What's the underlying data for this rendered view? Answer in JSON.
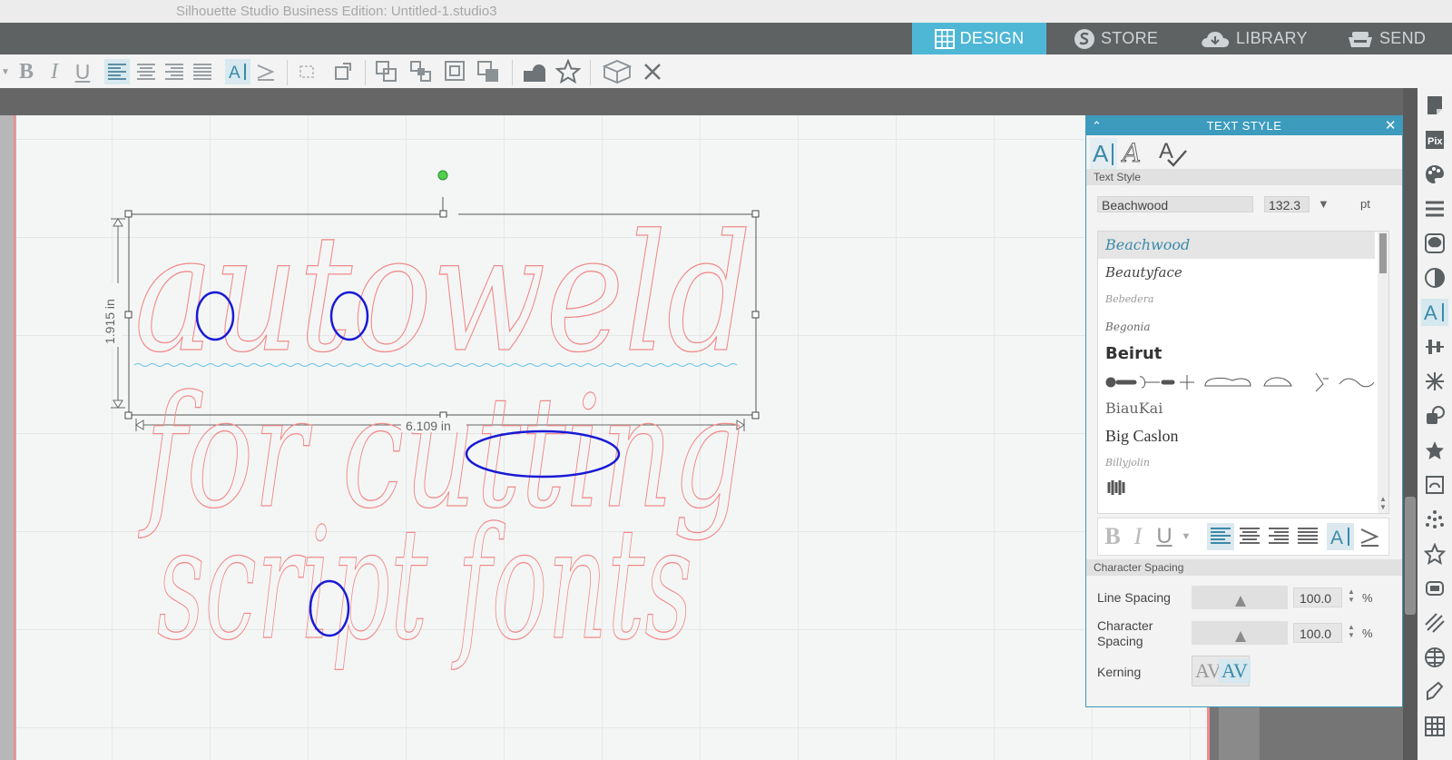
{
  "window": {
    "title": "Silhouette Studio Business Edition: Untitled-1.studio3"
  },
  "nav": {
    "tabs": [
      {
        "label": "DESIGN",
        "icon": "grid-icon",
        "active": true
      },
      {
        "label": "STORE",
        "icon": "silhouette-s-icon",
        "active": false
      },
      {
        "label": "LIBRARY",
        "icon": "cloud-download-icon",
        "active": false
      },
      {
        "label": "SEND",
        "icon": "cutter-icon",
        "active": false
      }
    ]
  },
  "toolbar": {
    "bold": "B",
    "italic": "I",
    "underline": "U"
  },
  "canvas": {
    "lines": [
      "autoweld",
      "for cutting",
      "script fonts"
    ],
    "height_label": "1.915 in",
    "width_label": "6.109 in",
    "outline_color": "#f08a8a",
    "annotation_color": "#1a1ad6",
    "baseline_color": "#61c3e6"
  },
  "panel": {
    "title": "TEXT STYLE",
    "section_text_style": "Text Style",
    "font_name": "Beachwood",
    "font_size": "132.3",
    "font_unit": "pt",
    "fonts": [
      "Beachwood",
      "Beautyface",
      "Bebedera",
      "Begonia",
      "Beirut",
      "",
      "BiauKai",
      "Big Caslon",
      "Billyjolin",
      ""
    ],
    "format": {
      "bold": "B",
      "italic": "I",
      "underline": "U"
    },
    "section_spacing": "Character Spacing",
    "line_spacing_label": "Line Spacing",
    "line_spacing_value": "100.0",
    "char_spacing_label": "Character Spacing",
    "char_spacing_value": "100.0",
    "percent": "%",
    "kerning_label": "Kerning",
    "kerning_a": "AV",
    "kerning_b": "AV"
  }
}
